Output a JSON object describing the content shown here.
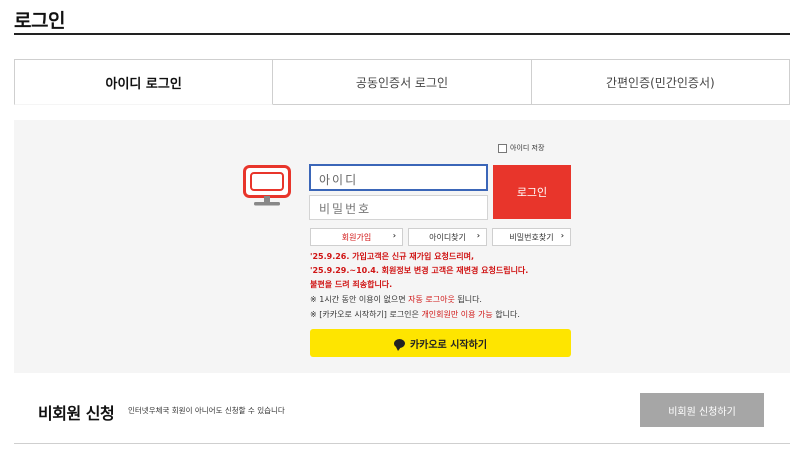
{
  "page": {
    "title": "로그인"
  },
  "tabs": [
    {
      "label": "아이디 로그인",
      "active": true
    },
    {
      "label": "공동인증서 로그인",
      "active": false
    },
    {
      "label": "간편인증(민간인증서)",
      "active": false
    }
  ],
  "login": {
    "save_id_label": "아이디 저장",
    "id_placeholder": "아이디",
    "password_placeholder": "비밀번호",
    "login_button": "로그인",
    "icon": "monitor-icon"
  },
  "links": {
    "join": "회원가입",
    "find_id": "아이디찾기",
    "find_password": "비밀번호찾기"
  },
  "notices": {
    "line1": "'25.9.26. 가입고객은 신규 재가입 요청드리며,",
    "line2": "'25.9.29.~10.4. 회원정보 변경 고객은 재변경 요청드립니다.",
    "line3": "불편을 드려 죄송합니다.",
    "line4_prefix": "※ 1시간 동안 이용이 없으면 ",
    "line4_highlight": "자동 로그아웃",
    "line4_suffix": " 됩니다.",
    "line5_prefix": "※ [카카오로 시작하기] 로그인은 ",
    "line5_highlight": "개인회원만 이용 가능",
    "line5_suffix": " 합니다."
  },
  "kakao": {
    "label": "카카오로 시작하기"
  },
  "guest": {
    "title": "비회원 신청",
    "description": "인터넷우체국 회원이 아니어도 신청할 수 있습니다",
    "button": "비회원 신청하기"
  },
  "colors": {
    "accent_red": "#e8352b",
    "kakao_yellow": "#fee500",
    "input_focus_blue": "#3b66b8",
    "guest_button_gray": "#a6a6a6"
  }
}
